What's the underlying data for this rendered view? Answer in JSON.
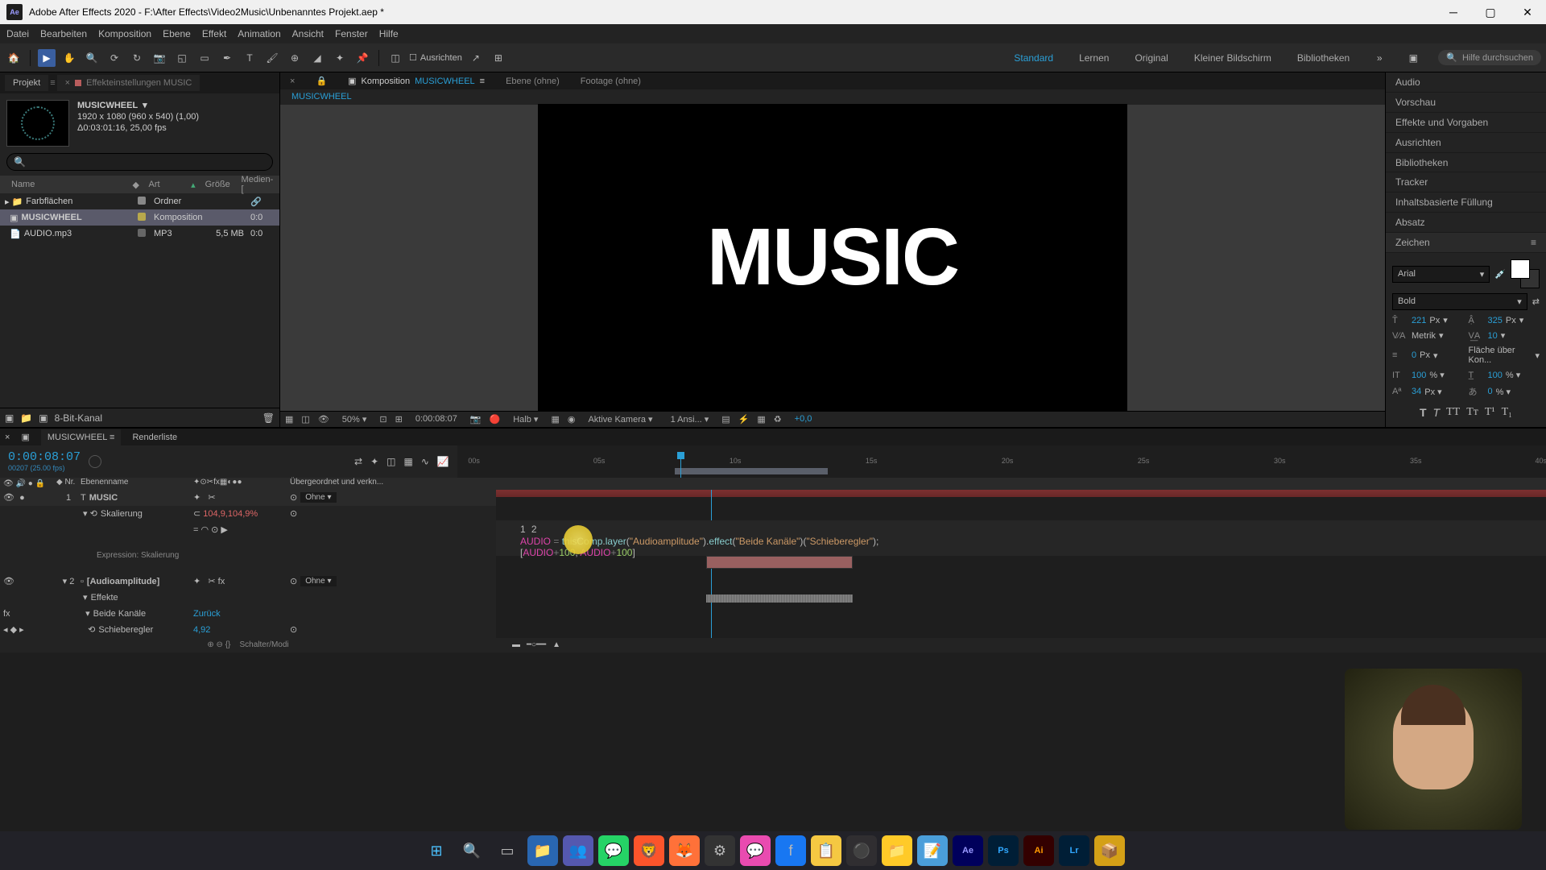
{
  "titlebar": {
    "app": "Adobe After Effects 2020",
    "path": "F:\\After Effects\\Video2Music\\Unbenanntes Projekt.aep *"
  },
  "menubar": [
    "Datei",
    "Bearbeiten",
    "Komposition",
    "Ebene",
    "Effekt",
    "Animation",
    "Ansicht",
    "Fenster",
    "Hilfe"
  ],
  "toolbar": {
    "align": "Ausrichten",
    "workspaces": [
      "Standard",
      "Lernen",
      "Original",
      "Kleiner Bildschirm",
      "Bibliotheken"
    ],
    "search_ph": "Hilfe durchsuchen"
  },
  "project": {
    "tabs": {
      "projekt": "Projekt",
      "effekt": "Effekteinstellungen  MUSIC"
    },
    "name": "MUSICWHEEL",
    "dims": "1920 x 1080 (960 x 540) (1,00)",
    "dur": "Δ0:03:01:16, 25,00 fps",
    "cols": {
      "name": "Name",
      "art": "Art",
      "size": "Größe",
      "media": "Medien-["
    },
    "items": [
      {
        "name": "Farbflächen",
        "art": "Ordner",
        "size": "",
        "label": "#888"
      },
      {
        "name": "MUSICWHEEL",
        "art": "Komposition",
        "size": "",
        "media": "0:0",
        "label": "#b8a84c"
      },
      {
        "name": "AUDIO.mp3",
        "art": "MP3",
        "size": "5,5 MB",
        "media": "0:0",
        "label": "#666"
      }
    ],
    "bit": "8-Bit-Kanal"
  },
  "comp": {
    "tabs": {
      "comp": "Komposition",
      "name": "MUSICWHEEL",
      "ebene": "Ebene  (ohne)",
      "footage": "Footage  (ohne)"
    },
    "canvas_text": "MUSIC",
    "footer": {
      "zoom": "50%",
      "tc": "0:00:08:07",
      "res": "Halb",
      "cam": "Aktive Kamera",
      "views": "1 Ansi...",
      "exp": "+0,0"
    }
  },
  "rightPanels": [
    "Audio",
    "Vorschau",
    "Effekte und Vorgaben",
    "Ausrichten",
    "Bibliotheken",
    "Tracker",
    "Inhaltsbasierte Füllung",
    "Absatz",
    "Zeichen"
  ],
  "char": {
    "font": "Arial",
    "weight": "Bold",
    "size": "221",
    "size_u": "Px",
    "lead": "325",
    "lead_u": "Px",
    "kern": "Metrik",
    "track": "10",
    "stroke": "0",
    "stroke_u": "Px",
    "fill": "Fläche über Kon...",
    "vscale": "100",
    "hscale": "100",
    "baseline": "34",
    "tsume": "0"
  },
  "timeline": {
    "tab": "MUSICWHEEL",
    "render": "Renderliste",
    "tc": "0:00:08:07",
    "frames": "00207 (25.00 fps)",
    "cols": {
      "nr": "Nr.",
      "name": "Ebenenname",
      "parent": "Übergeordnet und verkn..."
    },
    "ticks": [
      "00s",
      "05s",
      "10s",
      "15s",
      "20s",
      "25s",
      "30s",
      "35s",
      "40s"
    ],
    "layer1": {
      "num": "1",
      "name": "MUSIC",
      "parent": "Ohne",
      "prop": "Skalierung",
      "val": "104,9,104,9%",
      "expr_lbl": "Expression: Skalierung"
    },
    "layer2": {
      "num": "2",
      "name": "[Audioamplitude]",
      "parent": "Ohne",
      "fx": "Effekte",
      "eff": "Beide Kanäle",
      "reset": "Zurück",
      "slider": "Schieberegler",
      "sval": "4,92"
    },
    "expr": {
      "l1": {
        "v": "AUDIO",
        "eq": " = ",
        "f1": "thisComp",
        "d1": ".",
        "f2": "layer",
        "p1": "(",
        "s1": "\"Audioamplitude\"",
        "p2": ").",
        "f3": "effect",
        "p3": "(",
        "s2": "\"Beide Kanäle\"",
        "p4": ")(",
        "s3": "\"Schieberegler\"",
        "p5": ");"
      },
      "l2": {
        "b1": "[",
        "v1": "AUDIO",
        "op1": "+",
        "n1": "100",
        "c": ", ",
        "v2": "AUDIO",
        "op2": "+",
        "n2": "100",
        "b2": "]"
      }
    },
    "footer": "Schalter/Modi"
  }
}
